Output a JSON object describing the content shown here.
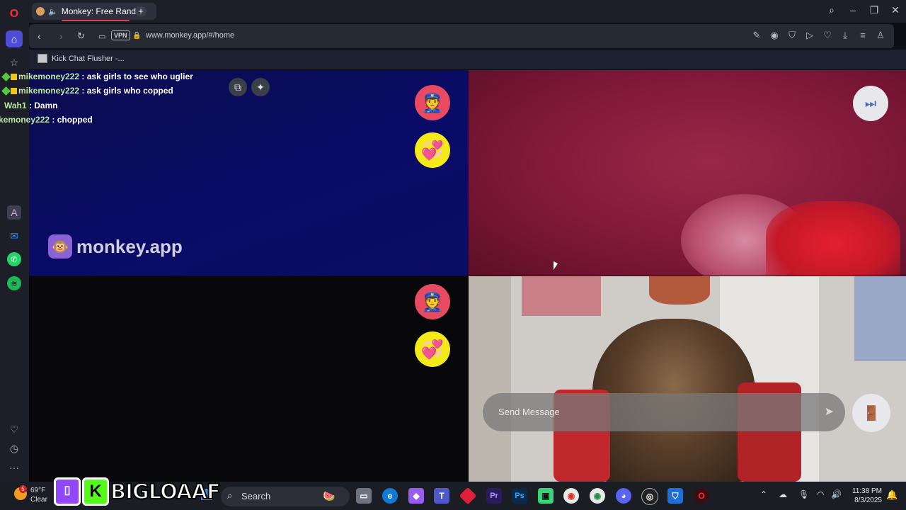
{
  "browser": {
    "tab_title": "Monkey: Free Randon",
    "url": "www.monkey.app/#/home",
    "vpn_label": "VPN",
    "bookmark": "Kick Chat Flusher -..."
  },
  "chat": [
    {
      "user": "mikemoney222",
      "text": ": ask girls to see who uglier"
    },
    {
      "user": "mikemoney222",
      "text": ": ask girls who copped"
    },
    {
      "user": "Wah1",
      "text": ": Damn"
    },
    {
      "user": "kemoney222",
      "text": ": chopped"
    }
  ],
  "app": {
    "logo_text": "monkey.app",
    "message_placeholder": "Send Message"
  },
  "icons": {
    "police": "👮",
    "heart": "💞",
    "monkey": "🐵"
  },
  "colors": {
    "police_bg": "#e84a62",
    "heart_bg": "#f4ea1a",
    "accent": "#e23c4e"
  },
  "taskbar": {
    "temp": "69°F",
    "weather": "Clear",
    "weather_badge": "5",
    "search": "Search",
    "time": "11:38 PM",
    "date": "8/3/2025",
    "streamer": "BIGLOAAF"
  }
}
